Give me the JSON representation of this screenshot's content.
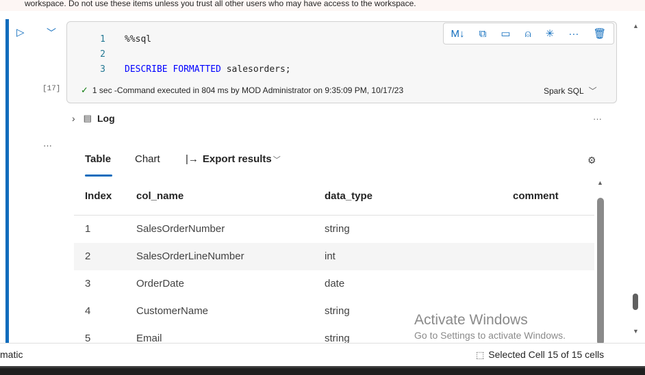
{
  "banner": {
    "text": "workspace. Do not use these items unless you trust all other users who may have access to the workspace."
  },
  "cell": {
    "run_icon": "▷",
    "collapse_icon": "﹀",
    "exec_count": "[17]",
    "code_lines": [
      {
        "num": "1",
        "prefix": "",
        "keyword": "",
        "text": "%%sql"
      },
      {
        "num": "2",
        "prefix": "",
        "keyword": "",
        "text": ""
      },
      {
        "num": "3",
        "prefix": "",
        "keyword": "DESCRIBE FORMATTED",
        "text": " salesorders;"
      }
    ],
    "toolbar": {
      "markdown_icon": "M↓",
      "convert_icon": "⧉",
      "comment_icon": "▭",
      "lock_icon": "⍝",
      "freeze_icon": "✳",
      "more_icon": "···",
      "delete_icon": "🗑"
    },
    "status": {
      "check_icon": "✓",
      "duration": "1 sec",
      "message": " -Command executed in 804 ms by MOD Administrator on 9:35:09 PM, 10/17/23"
    },
    "language": "Spark SQL",
    "language_caret": "﹀"
  },
  "log": {
    "chevron": "›",
    "icon": "▤",
    "label": "Log",
    "more": "···"
  },
  "output": {
    "more": "···",
    "tabs": {
      "table": "Table",
      "chart": "Chart",
      "export_arrow": "|→",
      "export": "Export results",
      "export_caret": "﹀"
    },
    "settings_icon": "⚙",
    "columns": [
      "Index",
      "col_name",
      "data_type",
      "comment"
    ],
    "rows": [
      {
        "index": "1",
        "col_name": "SalesOrderNumber",
        "data_type": "string",
        "comment": ""
      },
      {
        "index": "2",
        "col_name": "SalesOrderLineNumber",
        "data_type": "int",
        "comment": ""
      },
      {
        "index": "3",
        "col_name": "OrderDate",
        "data_type": "date",
        "comment": ""
      },
      {
        "index": "4",
        "col_name": "CustomerName",
        "data_type": "string",
        "comment": ""
      },
      {
        "index": "5",
        "col_name": "Email",
        "data_type": "string",
        "comment": ""
      }
    ]
  },
  "watermark": {
    "line1": "Activate Windows",
    "line2": "Go to Settings to activate Windows."
  },
  "statusbar": {
    "left": "matic",
    "cell_icon": "⬚",
    "right": "Selected Cell 15 of 15 cells"
  },
  "colors": {
    "accent": "#0f6cbd",
    "success": "#107c10"
  }
}
